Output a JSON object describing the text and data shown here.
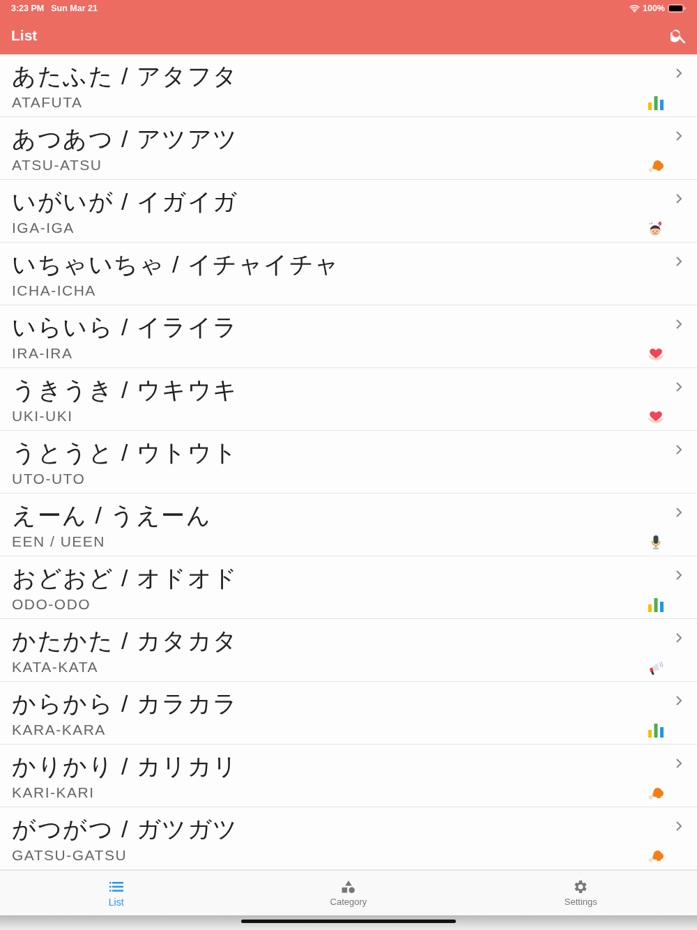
{
  "status_bar": {
    "time": "3:23 PM",
    "date": "Sun Mar 21",
    "battery": "100%"
  },
  "nav_bar": {
    "title": "List"
  },
  "rows": [
    {
      "title": "あたふた / アタフタ",
      "romaji": "ATAFUTA",
      "kind": "chart"
    },
    {
      "title": "あつあつ / アツアツ",
      "romaji": "ATSU-ATSU",
      "kind": "food"
    },
    {
      "title": "いがいが / イガイガ",
      "romaji": "IGA-IGA",
      "kind": "pain"
    },
    {
      "title": "いちゃいちゃ / イチャイチャ",
      "romaji": "ICHA-ICHA",
      "kind": "plain"
    },
    {
      "title": "いらいら / イライラ",
      "romaji": "IRA-IRA",
      "kind": "heart"
    },
    {
      "title": "うきうき / ウキウキ",
      "romaji": "UKI-UKI",
      "kind": "heart"
    },
    {
      "title": "うとうと / ウトウト",
      "romaji": "UTO-UTO",
      "kind": "plain"
    },
    {
      "title": "えーん / うえーん",
      "romaji": "EEN / UEEN",
      "kind": "voice"
    },
    {
      "title": "おどおど / オドオド",
      "romaji": "ODO-ODO",
      "kind": "chart"
    },
    {
      "title": "かたかた / カタカタ",
      "romaji": "KATA-KATA",
      "kind": "shout"
    },
    {
      "title": "からから / カラカラ",
      "romaji": "KARA-KARA",
      "kind": "chart"
    },
    {
      "title": "かりかり / カリカリ",
      "romaji": "KARI-KARI",
      "kind": "food"
    },
    {
      "title": "がつがつ / ガツガツ",
      "romaji": "GATSU-GATSU",
      "kind": "food"
    }
  ],
  "tab_bar": [
    {
      "label": "List",
      "kind": "list",
      "selected": true
    },
    {
      "label": "Category",
      "kind": "shapes",
      "selected": false
    },
    {
      "label": "Settings",
      "kind": "gear",
      "selected": false
    }
  ]
}
